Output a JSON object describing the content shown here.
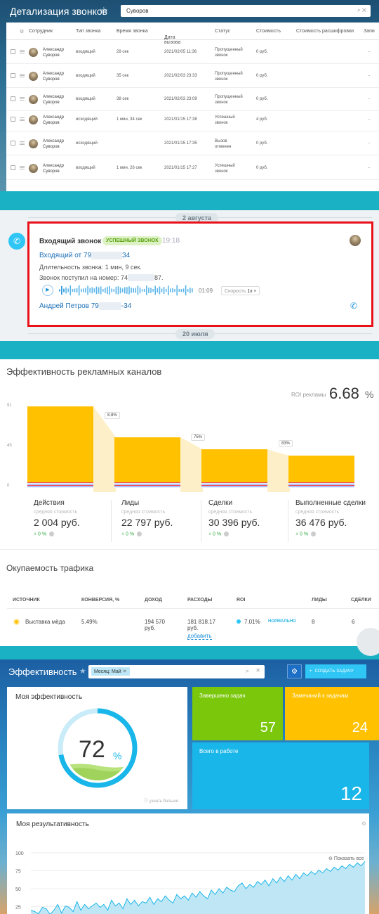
{
  "panel1": {
    "title": "Детализация звонков",
    "search_value": "Суворов",
    "columns": [
      "Сотрудник",
      "Тип звонка",
      "Время звонка",
      "Дата вызова",
      "Статус",
      "Стоимость",
      "Стоимость расшифровки",
      "Запи"
    ],
    "rows": [
      {
        "name": "Александр Суворов",
        "type": "входящий",
        "duration": "29 сек",
        "date": "2021/02/05 11:36",
        "status": "Пропущенный звонок",
        "cost": "0 руб.",
        "decode": "-"
      },
      {
        "name": "Александр Суворов",
        "type": "входящий",
        "duration": "35 сек",
        "date": "2021/02/03 23:33",
        "status": "Пропущенный звонок",
        "cost": "0 руб.",
        "decode": "-"
      },
      {
        "name": "Александр Суворов",
        "type": "входящий",
        "duration": "38 сек",
        "date": "2021/02/03 23:09",
        "status": "Пропущенный звонок",
        "cost": "0 руб.",
        "decode": "-"
      },
      {
        "name": "Александр Суворов",
        "type": "исходящий",
        "duration": "1 мин, 34 сек",
        "date": "2021/01/15 17:38",
        "status": "Успешный звонок",
        "cost": "4 руб.",
        "decode": "-"
      },
      {
        "name": "Александр Суворов",
        "type": "исходящий",
        "duration": "",
        "date": "2021/01/15 17:35",
        "status": "Вызов отменен",
        "cost": "0 руб.",
        "decode": "-"
      },
      {
        "name": "Александр Суворов",
        "type": "входящий",
        "duration": "1 мин, 26 сек",
        "date": "2021/01/15 17:27",
        "status": "Успешный звонок",
        "cost": "0 руб.",
        "decode": "-"
      }
    ]
  },
  "panel2": {
    "date_top": "2 августа",
    "date_bottom": "20 июля",
    "call_title": "Входящий звонок",
    "badge": "УСПЕШНЫЙ ЗВОНОК",
    "time": "19:18",
    "from_prefix": "Входящий от 79",
    "from_suffix": "34",
    "duration_line": "Длительность звонка: 1 мин, 9 сек.",
    "number_prefix": "Звонок поступил на номер: 74",
    "number_suffix": "87.",
    "audio_time": "01:09",
    "speed_label": "Скорость",
    "speed_value": "1x",
    "contact_prefix": "Андрей Петров 79",
    "contact_suffix": "-34"
  },
  "panel3": {
    "title": "Эффективность рекламных каналов",
    "roi_label": "ROI рекламы",
    "roi_value": "6.68",
    "roi_unit": "%",
    "chart_data": {
      "type": "bar",
      "categories": [
        "Действия",
        "Лиды",
        "Сделки",
        "Выполненные сделки"
      ],
      "values": [
        91,
        56,
        42,
        35
      ],
      "ylim": [
        0,
        91
      ],
      "yticks": [
        "91",
        "45",
        "0"
      ],
      "conversions": [
        "8.8%",
        "75%",
        "83%"
      ]
    },
    "stages": [
      {
        "name": "Действия",
        "sub": "средняя стоимость",
        "value": "2 004 руб.",
        "delta": "+ 0 %"
      },
      {
        "name": "Лиды",
        "sub": "средняя стоимость",
        "value": "22 797 руб.",
        "delta": "+ 0 %"
      },
      {
        "name": "Сделки",
        "sub": "средняя стоимость",
        "value": "30 396 руб.",
        "delta": "+ 0 %"
      },
      {
        "name": "Выполненные сделки",
        "sub": "средняя стоимость",
        "value": "36 476 руб.",
        "delta": "+ 0 %"
      }
    ],
    "title2": "Окупаемость трафика",
    "traffic_columns": [
      "ИСТОЧНИК",
      "КОНВЕРСИЯ, %",
      "ДОХОД",
      "РАСХОДЫ",
      "ROI",
      "ЛИДЫ",
      "СДЕЛКИ"
    ],
    "traffic_row": {
      "source": "Выставка мёда",
      "conversion": "5.49%",
      "income": "194 570 руб.",
      "expense": "181 818.17 руб.",
      "add": "добавить",
      "roi": "7.01%",
      "roi_status": "НОРМАЛЬНО",
      "leads": "8",
      "deals": "6"
    }
  },
  "panel4": {
    "title": "Эффективность",
    "filter_tag": "Месяц: Май",
    "create_label": "СОЗДАТЬ ЗАДАЧУ",
    "my_eff_title": "Моя эффективность",
    "my_eff_value": "72",
    "my_eff_unit": "%",
    "my_eff_level": 0.72,
    "learn_more": "узнать больше",
    "tiles": [
      {
        "label": "Завершено задач",
        "value": "57",
        "color": "#7ac70c"
      },
      {
        "label": "Замечаний к задачам",
        "value": "24",
        "color": "#ffc100"
      },
      {
        "label": "Всего в работе",
        "value": "12",
        "color": "#19b6e9"
      }
    ],
    "result_title": "Моя результативность",
    "show_all": "Показать все",
    "chart_data": {
      "type": "area",
      "yticks": [
        "100",
        "75",
        "50",
        "25"
      ],
      "ylim": [
        0,
        100
      ],
      "values": [
        20,
        18,
        15,
        24,
        22,
        14,
        20,
        28,
        16,
        26,
        24,
        18,
        32,
        20,
        28,
        22,
        26,
        30,
        24,
        28,
        20,
        34,
        26,
        30,
        22,
        36,
        28,
        34,
        26,
        32,
        30,
        38,
        28,
        36,
        32,
        40,
        34,
        30,
        42,
        36,
        40,
        34,
        44,
        38,
        46,
        40,
        36,
        48,
        42,
        50,
        44,
        52,
        48,
        46,
        54,
        58,
        50,
        56,
        52,
        60,
        56,
        62,
        54,
        64,
        58,
        66,
        60,
        68,
        62,
        70,
        64,
        72,
        68,
        74,
        70,
        76,
        72,
        78,
        74,
        80,
        76,
        82,
        78,
        84,
        80,
        86,
        82,
        88
      ]
    }
  }
}
